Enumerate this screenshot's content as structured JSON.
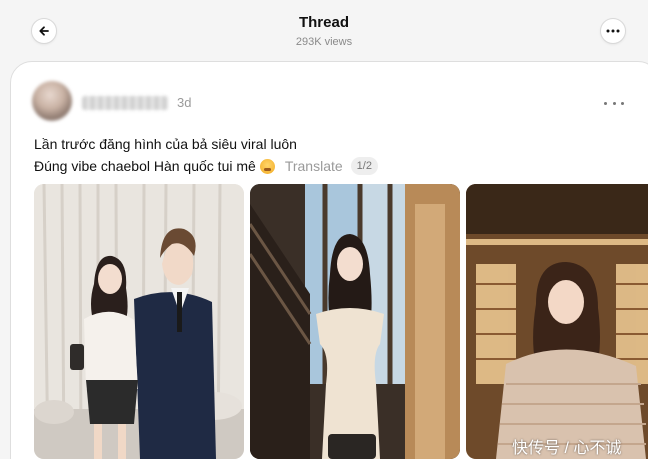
{
  "header": {
    "title": "Thread",
    "views": "293K views"
  },
  "post": {
    "time": "3d",
    "line1": "Lần trước đăng hình của bả siêu viral luôn",
    "line2": "Đúng vibe chaebol Hàn quốc tui mê",
    "translate_label": "Translate",
    "page_indicator": "1/2"
  },
  "watermark": "快传号 / 心不诚",
  "icons": {
    "back": "arrow-left-icon",
    "more": "more-horizontal-icon",
    "emoji": "crying-face-emoji"
  }
}
